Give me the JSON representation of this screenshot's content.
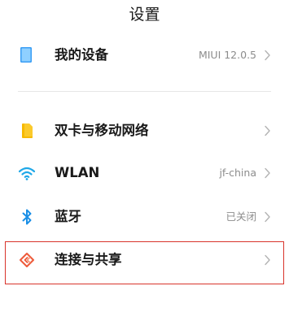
{
  "header": {
    "title": "设置"
  },
  "rows": {
    "device": {
      "label": "我的设备",
      "value": "MIUI 12.0.5"
    },
    "sim": {
      "label": "双卡与移动网络",
      "value": ""
    },
    "wlan": {
      "label": "WLAN",
      "value": "jf-china"
    },
    "bt": {
      "label": "蓝牙",
      "value": "已关闭"
    },
    "share": {
      "label": "连接与共享",
      "value": ""
    }
  },
  "colors": {
    "device_icon": "#3a9ef5",
    "sim_icon": "#f6b900",
    "wlan_icon": "#1fa8e8",
    "bt_icon": "#1a8fe6",
    "share_icon": "#ee5a3a",
    "highlight": "#d9342b"
  },
  "icons": {
    "device": "device-icon",
    "sim": "sim-card-icon",
    "wlan": "wifi-icon",
    "bt": "bluetooth-icon",
    "share": "connection-share-icon",
    "chevron": "chevron-right-icon"
  }
}
